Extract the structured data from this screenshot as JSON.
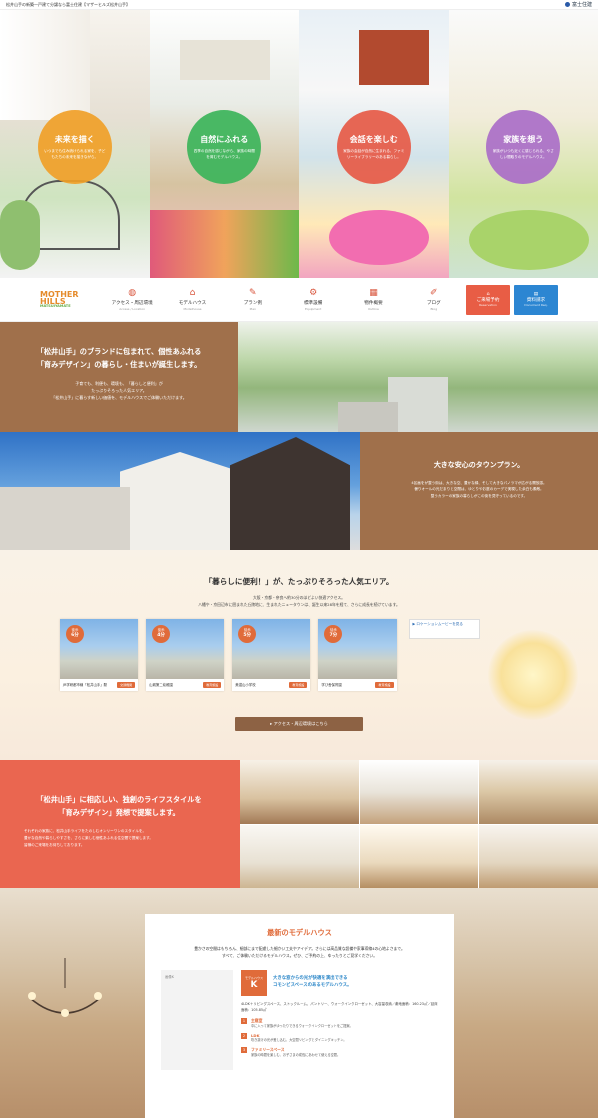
{
  "topbar": {
    "caption": "松井山手の新築一戸建て分譲なら富士住建【マザーヒルズ松井山手】",
    "company": "富士住建"
  },
  "hero": {
    "panels": [
      {
        "title": "未来を描く",
        "desc": "いつまでも住み続けられる家を、子どもたちの未来を描きながら。"
      },
      {
        "title": "自然にふれる",
        "desc": "四季の自然を感じながら、家族の時間を育むモデルハウス。"
      },
      {
        "title": "会話を楽しむ",
        "desc": "家族の会話が自然に生まれる、ファミリーライブラリーのある暮らし。"
      },
      {
        "title": "家族を想う",
        "desc": "家族がいつも近くに感じられる、やさしい間取りのモデルハウス。"
      }
    ]
  },
  "nav": {
    "logo_line1": "MOTHER",
    "logo_line2": "HILLS",
    "logo_sub": "MATSUIYAMATE",
    "items": [
      {
        "icon": "◍",
        "label": "アクセス・周辺環境",
        "sub": "Access / Location"
      },
      {
        "icon": "⌂",
        "label": "モデルハウス",
        "sub": "Modelhouse"
      },
      {
        "icon": "✎",
        "label": "プラン例",
        "sub": "Plan"
      },
      {
        "icon": "⚙",
        "label": "標準設備",
        "sub": "Equipment"
      },
      {
        "icon": "▦",
        "label": "物件概要",
        "sub": "Outline"
      },
      {
        "icon": "✐",
        "label": "ブログ",
        "sub": "Blog"
      }
    ],
    "reserve": {
      "label": "ご来場予約",
      "sub": "Reservation"
    },
    "docs": {
      "label": "資料請求",
      "sub": "Document Req."
    }
  },
  "brand": {
    "title1": "「松井山手」のブランドに包まれて、個性あふれる",
    "title2": "「育みデザイン」の暮らし・住まいが誕生します。",
    "body1": "子育ても、利便も、環境も、「暮らしと便利」が",
    "body2": "たっぷりそろった人気エリア。",
    "body3": "「松井山手」に暮らす新しい価値を、モデルハウスでご体験いただけます。"
  },
  "town": {
    "title": "大きな安心のタウンプラン。",
    "body1": "4区画をが整う街は、大きな空、豊かな緑、そして大きなパノラマが広がる開放感。",
    "body2": "曇りオールの光だまりと空間は、ゆとりやお庭のカーデで実現した余白も素敵。",
    "body3": "整うカラーの家族の暮らしがこの街を見守っているのです。"
  },
  "area": {
    "title": "「暮らしに便利！」が、たっぷりそろった人気エリア。",
    "line1": "大阪・京都・奈良へ約30分のほどよい快適アクセス。",
    "line2": "八幡や・京田辺市に囲まれた丘陵地に、生まれたニュータウンは、誕生以来28年を経て、さらに成長を続けています。",
    "cards": [
      {
        "badge_top": "徒歩",
        "badge_num": "6分",
        "name": "JR学研都市線「松井山手」駅",
        "tag": "交通機関"
      },
      {
        "badge_top": "徒歩",
        "badge_num": "4分",
        "name": "山城第二幼稚園",
        "tag": "教育施設"
      },
      {
        "badge_top": "徒歩",
        "badge_num": "5分",
        "name": "美濃山小学校",
        "tag": "教育施設"
      },
      {
        "badge_top": "徒歩",
        "badge_num": "7分",
        "name": "学び舎保育園",
        "tag": "教育施設"
      }
    ],
    "video_label": "ロケーションムービーを見る",
    "button": "アクセス・周辺環境はこちら"
  },
  "style": {
    "title1": "「松井山手」に相応しい、独創のライフスタイルを",
    "title2": "「育みデザイン」発想で提案します。",
    "body1": "それぞれの家族に、松井山手ライフをたのしむオンリーワンのスタイルを。",
    "body2": "豊かな自然や暮らしやすさを、さらに楽しむ個性あふれる住空間で提案します。",
    "body3": "皆様のご来場をお待ちしております。"
  },
  "model": {
    "title": "最新のモデルハウス",
    "intro1": "豊かさの空間はもちろん、細部にまで配慮した細かい工夫やアイデア。さらには高品質な設備や家事導線4の心地よさまで。",
    "intro2": "すべて、ご体験いただけるモデルハウス。ぜひ、ご予約の上、ゆったりとご見学ください。",
    "img_alt": "画像K",
    "kbox_label": "モデルハウス",
    "kbox_letter": "K",
    "catch1": "大きな窓からの光が快適を演出できる",
    "catch2": "コモンビスペースのあるモデルハウス。",
    "spec": "4LDK＋リビングスペース、ストックルーム、パントリー、ウォークインクローゼット、大容量収納／敷地面積：160.23㎡／延床面積：105.85㎡",
    "features": [
      {
        "num": "1",
        "title": "主寝室",
        "text": "中に入って家族がゆったりできるウォークインクローゼットをご提案。"
      },
      {
        "num": "2",
        "title": "LDK",
        "text": "吹き抜けの光が差し込む、大空間リビングとダイニングキッチン。"
      },
      {
        "num": "3",
        "title": "ファミリースペース",
        "text": "家族の時間を楽しむ、お子さまの成長にあわせて使える空間。"
      }
    ]
  }
}
